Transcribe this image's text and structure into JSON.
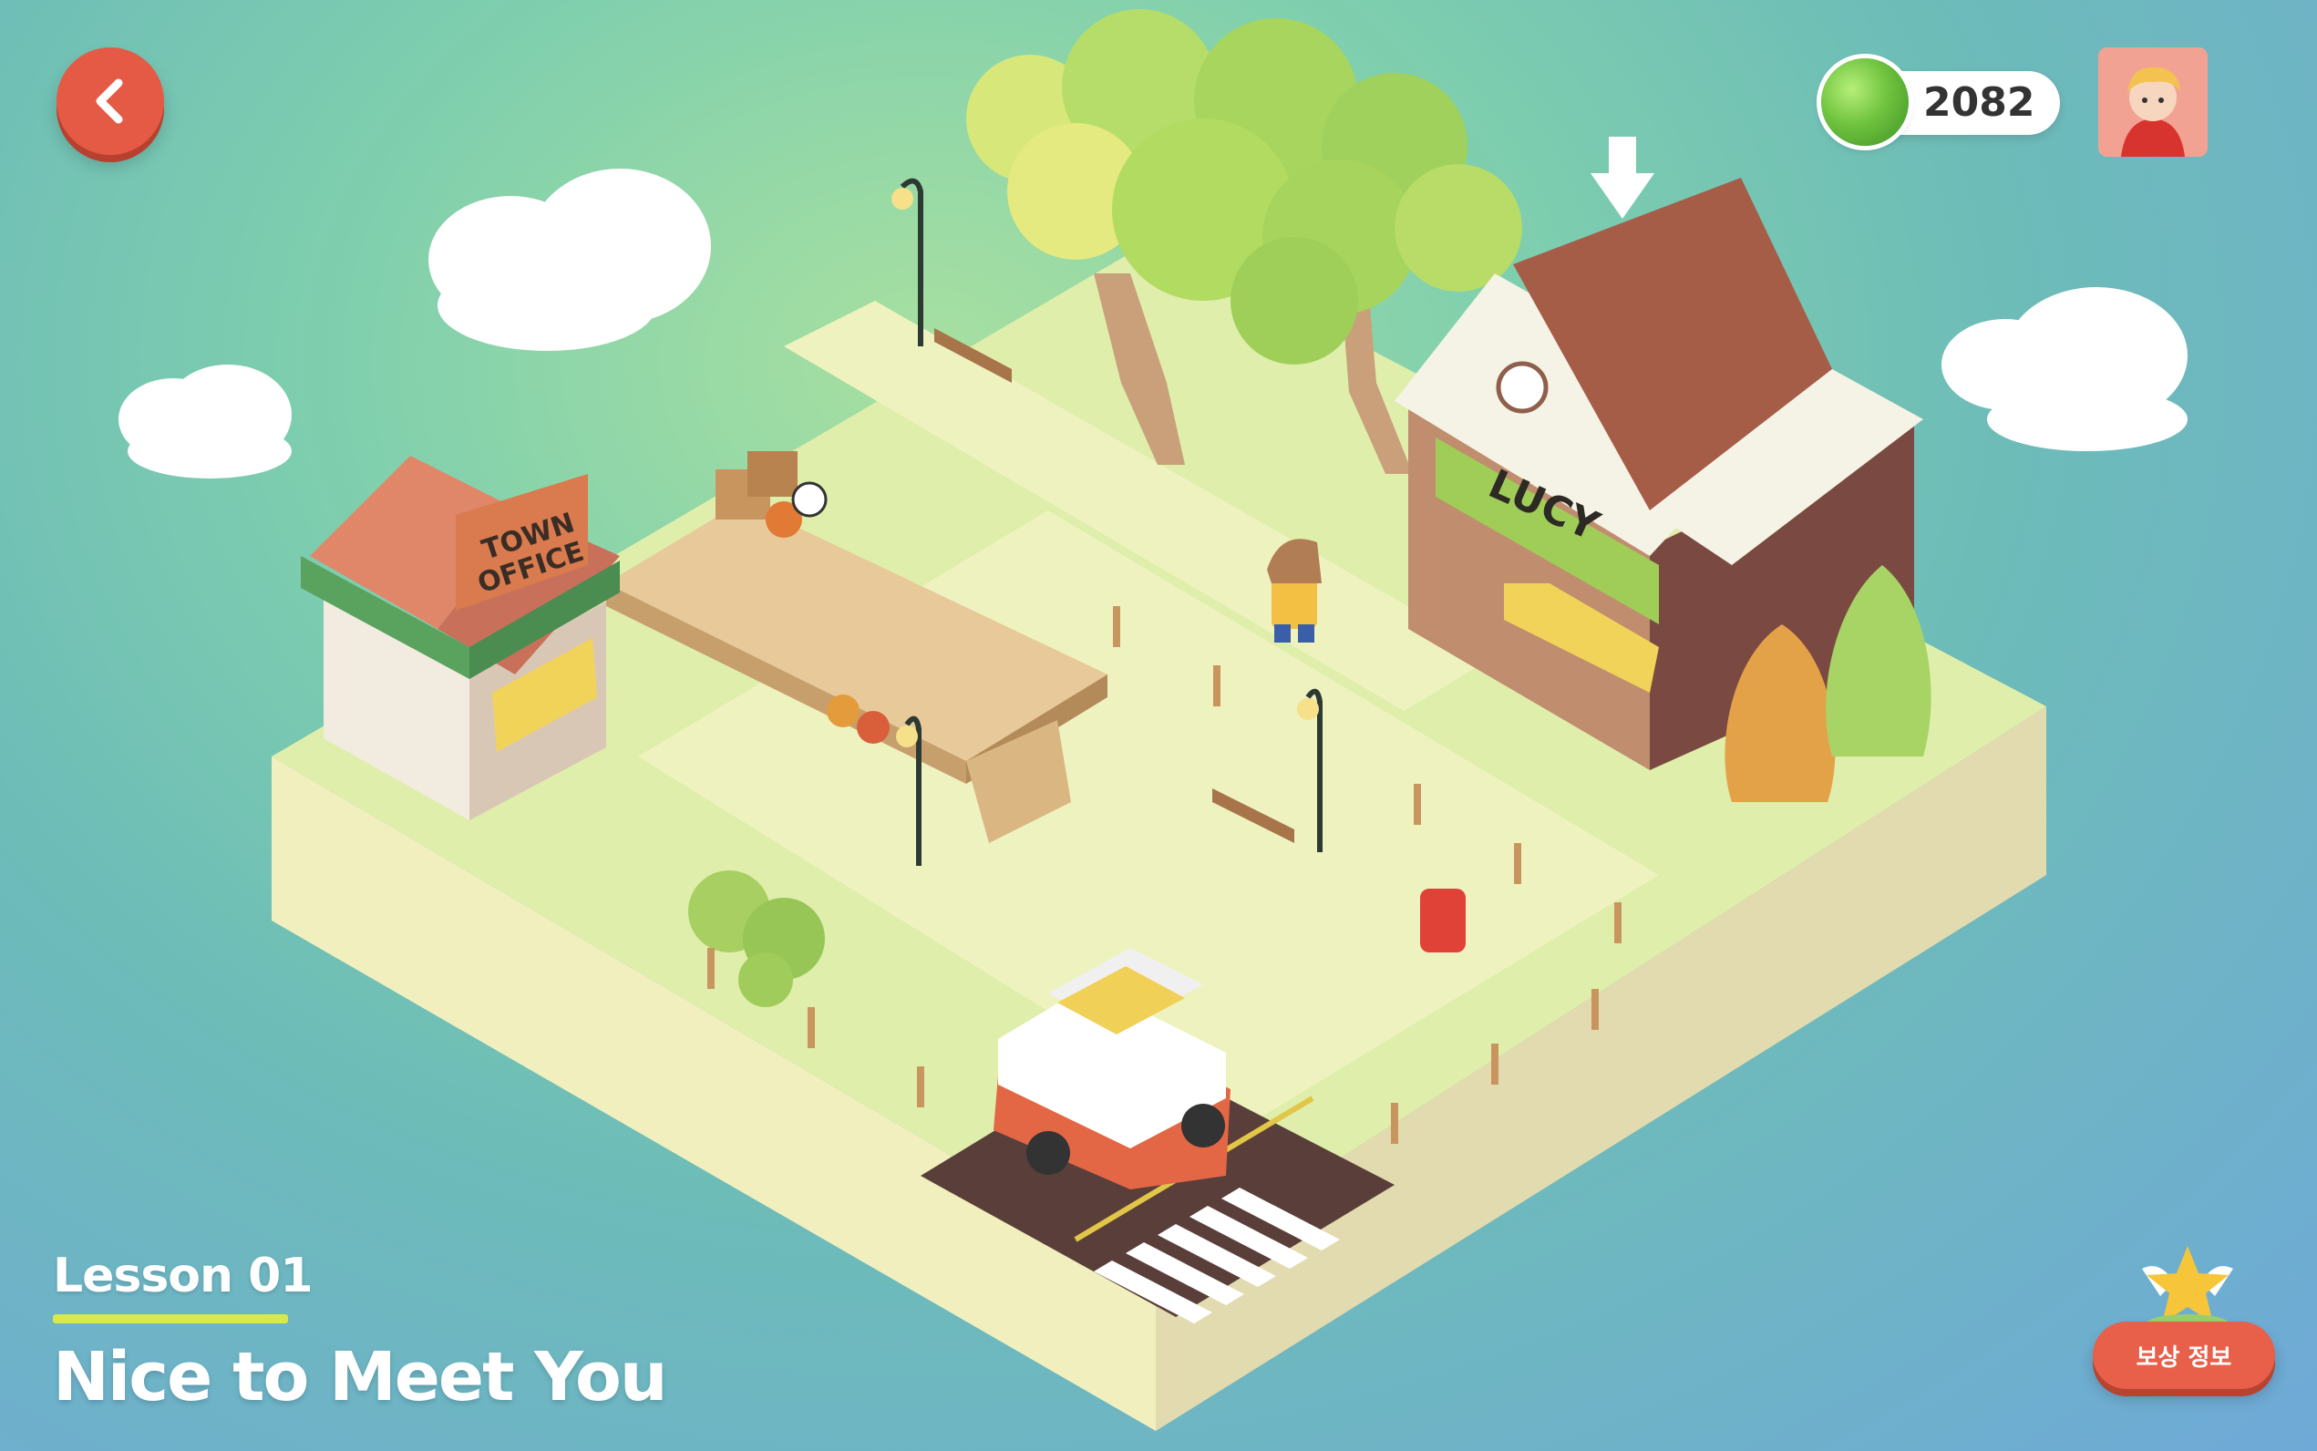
{
  "hud": {
    "coins": "2082",
    "reward_button_label": "보상 정보"
  },
  "lesson": {
    "number_label": "Lesson 01",
    "title": "Nice to Meet You"
  },
  "buildings": {
    "town_office_sign_line1": "TOWN",
    "town_office_sign_line2": "OFFICE",
    "shop_sign": "LUCY"
  },
  "colors": {
    "accent_red": "#e55a45",
    "underline_yellow": "#d9e84a",
    "grass": "#dfeeab",
    "ground": "#f1efbe"
  },
  "icons": [
    "back-arrow-icon",
    "coin-icon",
    "avatar-icon",
    "star-icon",
    "down-arrow-icon"
  ]
}
